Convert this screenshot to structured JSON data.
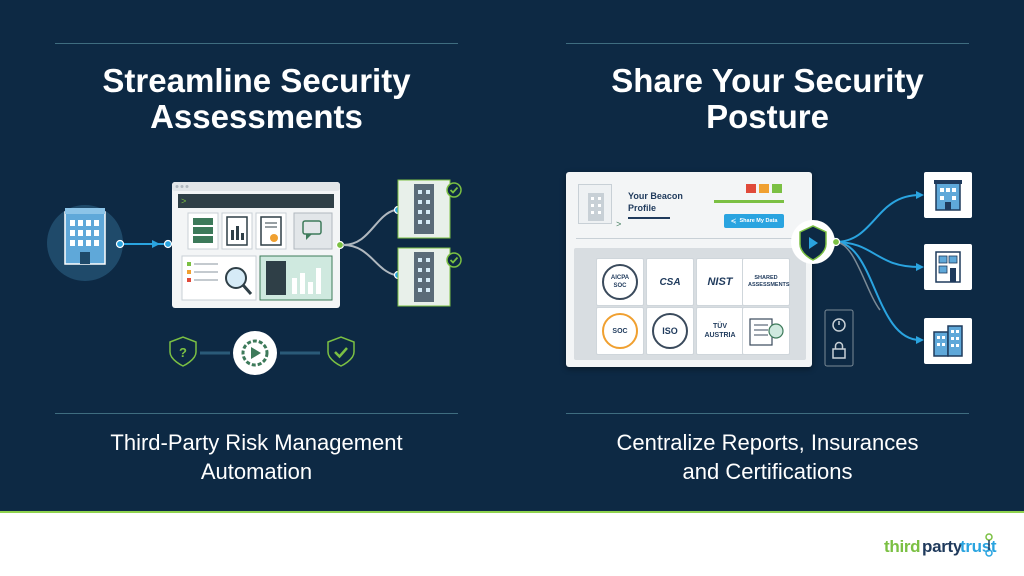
{
  "left": {
    "heading_line1": "Streamline Security",
    "heading_line2": "Assessments",
    "caption_line1": "Third-Party Risk Management",
    "caption_line2": "Automation"
  },
  "right": {
    "heading_line1": "Share Your Security",
    "heading_line2": "Posture",
    "caption_line1": "Centralize Reports, Insurances",
    "caption_line2": "and Certifications",
    "profile_title_line1": "Your Beacon",
    "profile_title_line2": "Profile",
    "share_button": "Share My Data",
    "badges": [
      "AICPA SOC",
      "CSA",
      "NIST",
      "SHARED ASSESSMENTS",
      "SOC",
      "ISO",
      "TÜV AUSTRIA",
      ""
    ]
  },
  "brand": {
    "logo_part1": "third",
    "logo_part2": "party",
    "logo_part3": "trust"
  },
  "colors": {
    "background": "#0d2944",
    "accent_green": "#7bc043",
    "accent_teal": "#2aa4e0",
    "footer_bg": "#ffffff"
  },
  "icons": [
    "building-icon",
    "document-icon",
    "certificate-icon",
    "chat-icon",
    "magnifier-icon",
    "chart-icon",
    "checkmark-icon",
    "question-icon",
    "gear-play-icon",
    "shield-icon",
    "timer-icon",
    "lock-icon",
    "share-icon"
  ]
}
